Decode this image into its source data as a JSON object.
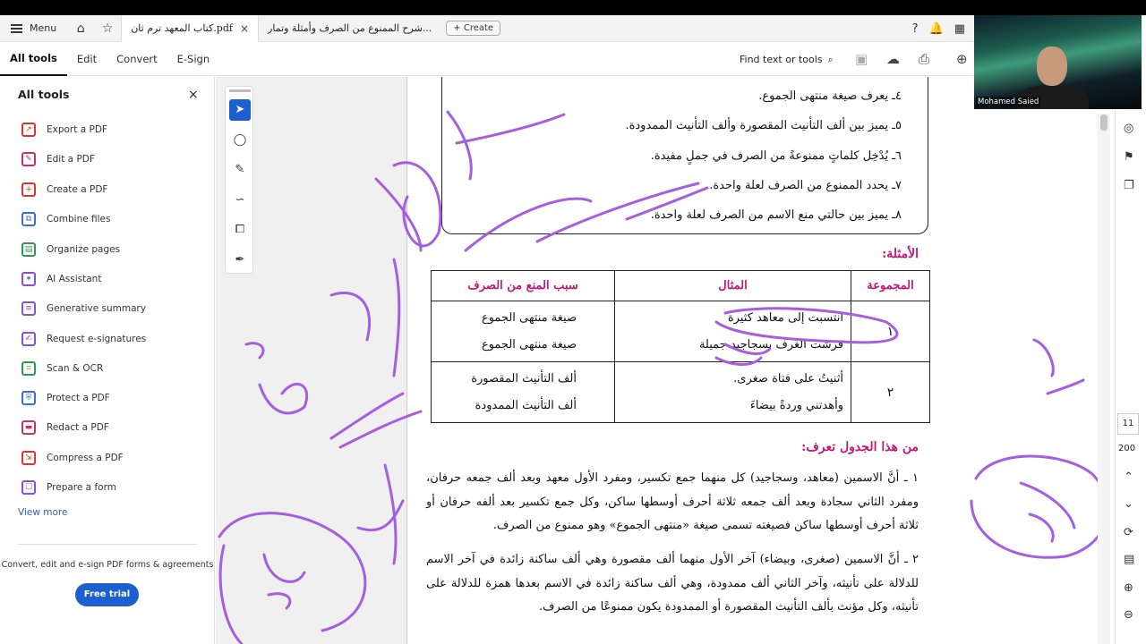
{
  "app": {
    "menu_label": "Menu",
    "create_label": "Create"
  },
  "tabs": [
    {
      "title": "كتاب المعهد ترم ثان.pdf",
      "close": "×"
    },
    {
      "title": "شرح الممنوع من الصرف وأمثلة وتمار..."
    }
  ],
  "toolbar": {
    "items": [
      "All tools",
      "Edit",
      "Convert",
      "E-Sign"
    ],
    "find": "Find text or tools"
  },
  "sidebar": {
    "title": "All tools",
    "close": "×",
    "items": [
      {
        "label": "Export a PDF",
        "icon": "export-pdf-icon"
      },
      {
        "label": "Edit a PDF",
        "icon": "edit-pdf-icon"
      },
      {
        "label": "Create a PDF",
        "icon": "create-pdf-icon"
      },
      {
        "label": "Combine files",
        "icon": "combine-files-icon"
      },
      {
        "label": "Organize pages",
        "icon": "organize-pages-icon"
      },
      {
        "label": "AI Assistant",
        "icon": "ai-assistant-icon"
      },
      {
        "label": "Generative summary",
        "icon": "generative-summary-icon"
      },
      {
        "label": "Request e-signatures",
        "icon": "request-esign-icon"
      },
      {
        "label": "Scan & OCR",
        "icon": "scan-ocr-icon"
      },
      {
        "label": "Protect a PDF",
        "icon": "protect-pdf-icon"
      },
      {
        "label": "Redact a PDF",
        "icon": "redact-pdf-icon"
      },
      {
        "label": "Compress a PDF",
        "icon": "compress-pdf-icon"
      },
      {
        "label": "Prepare a form",
        "icon": "prepare-form-icon"
      }
    ],
    "view_more": "View more",
    "promo": "Convert, edit and e-sign PDF forms & agreements",
    "trial": "Free trial"
  },
  "rightrail": {
    "page": "11",
    "zoom": "200"
  },
  "webcam": {
    "name": "Mohamed Saied"
  },
  "doc": {
    "objectives": [
      "٤ـ  يعرف صيغة منتهى الجموع.",
      "٥ـ  يميز بين ألف التأنيث المقصورة وألف التأنيث الممدودة.",
      "٦ـ  يُدْخِل كلماتٍ ممنوعةً من الصرف في جملٍ مفيدة.",
      "٧ـ  يحدد الممنوع من الصرف لعلة واحدة.",
      "٨ـ  يميز بين حالتي منع الاسم من الصرف لعلة واحدة."
    ],
    "examples_heading": "الأمثلة:",
    "table": {
      "headers": [
        "المجموعة",
        "المثال",
        "سبب المنع من الصرف"
      ],
      "rows": [
        {
          "group": "١",
          "examples": [
            "انتسبت إلى معاهد كثيرة",
            "فرشت الغرف بسجاجيد جميلة"
          ],
          "reasons": [
            "صيغة منتهى الجموع",
            "صيغة منتهى الجموع"
          ]
        },
        {
          "group": "٢",
          "examples": [
            "أثنيتُ على فتاة صغرى.",
            "وأهدتني وردةً بيضاءَ"
          ],
          "reasons": [
            "ألف التأنيث المقصورة",
            "ألف التأنيث الممدودة"
          ]
        }
      ]
    },
    "learn_heading": "من هذا الجدول تعرف:",
    "para1": "١ ـ أنَّ الاسمين (معاهد، وسجاجيد) كل منهما جمع تكسير، ومفرد الأول معهد وبعد ألف جمعه حرفان، ومفرد الثاني سجادة وبعد ألف جمعه ثلاثة أحرف أوسطها ساكن، وكل جمع تكسير بعد ألفه حرفان أو ثلاثة أحرف أوسطها ساكن فصيغته تسمى صيغة «منتهى الجموع» وهو ممنوع من الصرف.",
    "para2": "٢ ـ أنَّ الاسمين (صغرى، وبيضاء) آخر الأول منهما ألف مقصورة وهي ألف ساكنة زائدة في آخر الاسم للدلالة على تأنيثه، وآخر الثاني ألف ممدودة، وهي ألف ساكنة زائدة في الاسم بعدها همزة للدلالة على تأنيثه، وكل مؤنث بألف التأنيث المقصورة أو الممدودة يكون ممنوعًا من الصرف."
  },
  "colors": {
    "accent": "#1e5fcf",
    "heading": "#c0197a",
    "ink": "#a65ee0"
  }
}
